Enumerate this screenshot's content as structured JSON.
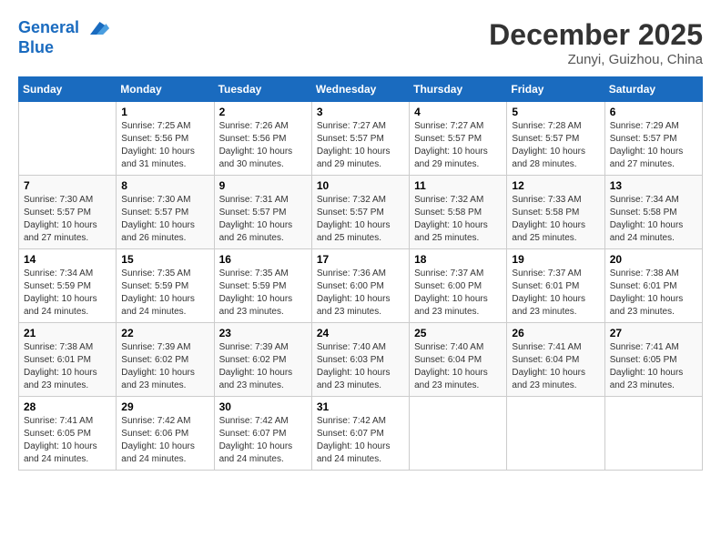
{
  "header": {
    "logo_line1": "General",
    "logo_line2": "Blue",
    "month": "December 2025",
    "location": "Zunyi, Guizhou, China"
  },
  "weekdays": [
    "Sunday",
    "Monday",
    "Tuesday",
    "Wednesday",
    "Thursday",
    "Friday",
    "Saturday"
  ],
  "weeks": [
    [
      {
        "day": "",
        "sunrise": "",
        "sunset": "",
        "daylight": ""
      },
      {
        "day": "1",
        "sunrise": "Sunrise: 7:25 AM",
        "sunset": "Sunset: 5:56 PM",
        "daylight": "Daylight: 10 hours and 31 minutes."
      },
      {
        "day": "2",
        "sunrise": "Sunrise: 7:26 AM",
        "sunset": "Sunset: 5:56 PM",
        "daylight": "Daylight: 10 hours and 30 minutes."
      },
      {
        "day": "3",
        "sunrise": "Sunrise: 7:27 AM",
        "sunset": "Sunset: 5:57 PM",
        "daylight": "Daylight: 10 hours and 29 minutes."
      },
      {
        "day": "4",
        "sunrise": "Sunrise: 7:27 AM",
        "sunset": "Sunset: 5:57 PM",
        "daylight": "Daylight: 10 hours and 29 minutes."
      },
      {
        "day": "5",
        "sunrise": "Sunrise: 7:28 AM",
        "sunset": "Sunset: 5:57 PM",
        "daylight": "Daylight: 10 hours and 28 minutes."
      },
      {
        "day": "6",
        "sunrise": "Sunrise: 7:29 AM",
        "sunset": "Sunset: 5:57 PM",
        "daylight": "Daylight: 10 hours and 27 minutes."
      }
    ],
    [
      {
        "day": "7",
        "sunrise": "Sunrise: 7:30 AM",
        "sunset": "Sunset: 5:57 PM",
        "daylight": "Daylight: 10 hours and 27 minutes."
      },
      {
        "day": "8",
        "sunrise": "Sunrise: 7:30 AM",
        "sunset": "Sunset: 5:57 PM",
        "daylight": "Daylight: 10 hours and 26 minutes."
      },
      {
        "day": "9",
        "sunrise": "Sunrise: 7:31 AM",
        "sunset": "Sunset: 5:57 PM",
        "daylight": "Daylight: 10 hours and 26 minutes."
      },
      {
        "day": "10",
        "sunrise": "Sunrise: 7:32 AM",
        "sunset": "Sunset: 5:57 PM",
        "daylight": "Daylight: 10 hours and 25 minutes."
      },
      {
        "day": "11",
        "sunrise": "Sunrise: 7:32 AM",
        "sunset": "Sunset: 5:58 PM",
        "daylight": "Daylight: 10 hours and 25 minutes."
      },
      {
        "day": "12",
        "sunrise": "Sunrise: 7:33 AM",
        "sunset": "Sunset: 5:58 PM",
        "daylight": "Daylight: 10 hours and 25 minutes."
      },
      {
        "day": "13",
        "sunrise": "Sunrise: 7:34 AM",
        "sunset": "Sunset: 5:58 PM",
        "daylight": "Daylight: 10 hours and 24 minutes."
      }
    ],
    [
      {
        "day": "14",
        "sunrise": "Sunrise: 7:34 AM",
        "sunset": "Sunset: 5:59 PM",
        "daylight": "Daylight: 10 hours and 24 minutes."
      },
      {
        "day": "15",
        "sunrise": "Sunrise: 7:35 AM",
        "sunset": "Sunset: 5:59 PM",
        "daylight": "Daylight: 10 hours and 24 minutes."
      },
      {
        "day": "16",
        "sunrise": "Sunrise: 7:35 AM",
        "sunset": "Sunset: 5:59 PM",
        "daylight": "Daylight: 10 hours and 23 minutes."
      },
      {
        "day": "17",
        "sunrise": "Sunrise: 7:36 AM",
        "sunset": "Sunset: 6:00 PM",
        "daylight": "Daylight: 10 hours and 23 minutes."
      },
      {
        "day": "18",
        "sunrise": "Sunrise: 7:37 AM",
        "sunset": "Sunset: 6:00 PM",
        "daylight": "Daylight: 10 hours and 23 minutes."
      },
      {
        "day": "19",
        "sunrise": "Sunrise: 7:37 AM",
        "sunset": "Sunset: 6:01 PM",
        "daylight": "Daylight: 10 hours and 23 minutes."
      },
      {
        "day": "20",
        "sunrise": "Sunrise: 7:38 AM",
        "sunset": "Sunset: 6:01 PM",
        "daylight": "Daylight: 10 hours and 23 minutes."
      }
    ],
    [
      {
        "day": "21",
        "sunrise": "Sunrise: 7:38 AM",
        "sunset": "Sunset: 6:01 PM",
        "daylight": "Daylight: 10 hours and 23 minutes."
      },
      {
        "day": "22",
        "sunrise": "Sunrise: 7:39 AM",
        "sunset": "Sunset: 6:02 PM",
        "daylight": "Daylight: 10 hours and 23 minutes."
      },
      {
        "day": "23",
        "sunrise": "Sunrise: 7:39 AM",
        "sunset": "Sunset: 6:02 PM",
        "daylight": "Daylight: 10 hours and 23 minutes."
      },
      {
        "day": "24",
        "sunrise": "Sunrise: 7:40 AM",
        "sunset": "Sunset: 6:03 PM",
        "daylight": "Daylight: 10 hours and 23 minutes."
      },
      {
        "day": "25",
        "sunrise": "Sunrise: 7:40 AM",
        "sunset": "Sunset: 6:04 PM",
        "daylight": "Daylight: 10 hours and 23 minutes."
      },
      {
        "day": "26",
        "sunrise": "Sunrise: 7:41 AM",
        "sunset": "Sunset: 6:04 PM",
        "daylight": "Daylight: 10 hours and 23 minutes."
      },
      {
        "day": "27",
        "sunrise": "Sunrise: 7:41 AM",
        "sunset": "Sunset: 6:05 PM",
        "daylight": "Daylight: 10 hours and 23 minutes."
      }
    ],
    [
      {
        "day": "28",
        "sunrise": "Sunrise: 7:41 AM",
        "sunset": "Sunset: 6:05 PM",
        "daylight": "Daylight: 10 hours and 24 minutes."
      },
      {
        "day": "29",
        "sunrise": "Sunrise: 7:42 AM",
        "sunset": "Sunset: 6:06 PM",
        "daylight": "Daylight: 10 hours and 24 minutes."
      },
      {
        "day": "30",
        "sunrise": "Sunrise: 7:42 AM",
        "sunset": "Sunset: 6:07 PM",
        "daylight": "Daylight: 10 hours and 24 minutes."
      },
      {
        "day": "31",
        "sunrise": "Sunrise: 7:42 AM",
        "sunset": "Sunset: 6:07 PM",
        "daylight": "Daylight: 10 hours and 24 minutes."
      },
      {
        "day": "",
        "sunrise": "",
        "sunset": "",
        "daylight": ""
      },
      {
        "day": "",
        "sunrise": "",
        "sunset": "",
        "daylight": ""
      },
      {
        "day": "",
        "sunrise": "",
        "sunset": "",
        "daylight": ""
      }
    ]
  ]
}
